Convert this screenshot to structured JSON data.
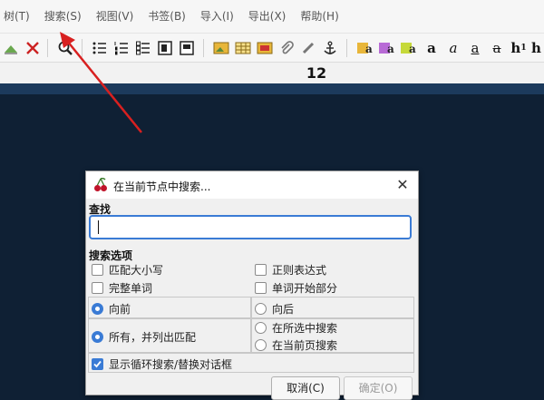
{
  "menubar": {
    "items": [
      "树(T)",
      "搜索(S)",
      "视图(V)",
      "书签(B)",
      "导入(I)",
      "导出(X)",
      "帮助(H)"
    ]
  },
  "toolbar": {
    "icons": [
      "import-icon",
      "export-pdf-icon",
      "find-icon",
      "bullet-list-icon",
      "numbered-list-icon",
      "todo-list-icon",
      "toggle-panel-icon",
      "toggle-panel-alt-icon",
      "insert-image-icon",
      "insert-table-icon",
      "insert-codebox-icon",
      "attach-file-icon",
      "insert-link-icon",
      "anchor-icon",
      "text-color-icon",
      "bg-color-icon",
      "remove-format-icon",
      "bold-icon",
      "italic-icon",
      "underline-icon",
      "strikethrough-icon",
      "heading-1-icon",
      "heading-2-icon"
    ],
    "text_buttons": {
      "bold": "a",
      "italic": "a",
      "underline": "a",
      "strike": "a",
      "h1": "h",
      "h1_sub": "1",
      "h2": "h"
    }
  },
  "font_size": {
    "value": "12"
  },
  "dialog": {
    "title": "在当前节点中搜索...",
    "find_label": "查找",
    "find_value": "",
    "options_label": "搜索选项",
    "options": {
      "match_case": {
        "label": "匹配大小写",
        "checked": false
      },
      "regex": {
        "label": "正则表达式",
        "checked": false
      },
      "whole_word": {
        "label": "完整单词",
        "checked": false
      },
      "word_start": {
        "label": "单词开始部分",
        "checked": false
      }
    },
    "direction": {
      "forward": {
        "label": "向前",
        "selected": true
      },
      "backward": {
        "label": "向后",
        "selected": false
      }
    },
    "scope": {
      "all_list": {
        "label": "所有，并列出匹配",
        "selected": true
      },
      "selected_nodes": {
        "label": "在所选中搜索",
        "selected": false
      },
      "current_page": {
        "label": "在当前页搜索",
        "selected": false
      }
    },
    "show_dialog": {
      "label": "显示循环搜索/替换对话框",
      "checked": true
    },
    "buttons": {
      "cancel": "取消(C)",
      "ok": "确定(O)"
    }
  },
  "colors": {
    "editor_bg": "#0f2034",
    "accent": "#3a7bd5",
    "annotation_arrow": "#d82020"
  }
}
